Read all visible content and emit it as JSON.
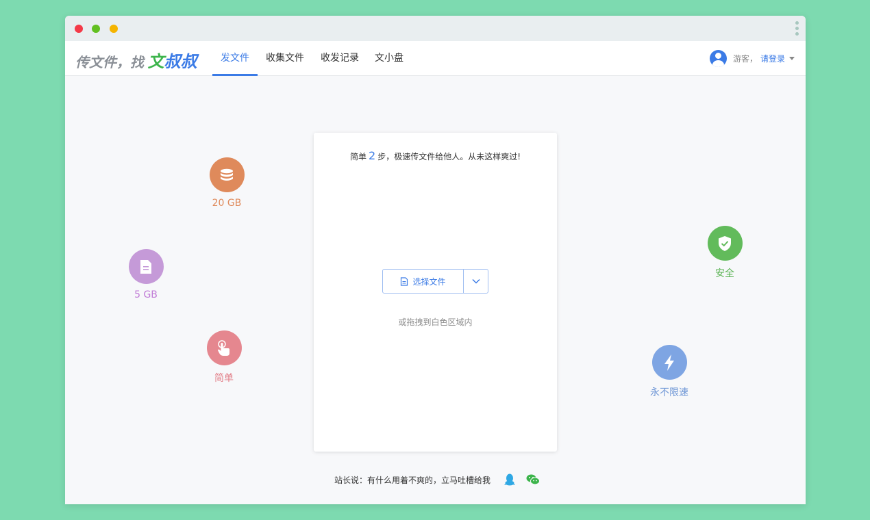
{
  "window": {
    "title_dots": [
      "close",
      "minimize",
      "maximize"
    ],
    "menu_icon": "vertical-dots-icon"
  },
  "logo": {
    "prefix": "传文件，找",
    "brand_wen": "文",
    "brand_shushu": "叔叔"
  },
  "nav": {
    "tabs": [
      {
        "label": "发文件",
        "active": true
      },
      {
        "label": "收集文件",
        "active": false
      },
      {
        "label": "收发记录",
        "active": false
      },
      {
        "label": "文小盘",
        "active": false
      }
    ]
  },
  "user": {
    "guest_label": "游客，",
    "login_label": "请登录",
    "avatar_icon": "user-avatar-icon"
  },
  "features": [
    {
      "label": "20 GB",
      "icon": "database-icon",
      "color": "#df8a5b"
    },
    {
      "label": "5 GB",
      "icon": "file-icon",
      "color": "#c59ad8"
    },
    {
      "label": "简单",
      "icon": "hand-pointer-icon",
      "color": "#e5878f"
    },
    {
      "label": "安全",
      "icon": "shield-check-icon",
      "color": "#62bb5b"
    },
    {
      "label": "永不限速",
      "icon": "lightning-icon",
      "color": "#7ea5e3"
    }
  ],
  "upload": {
    "headline_pre": "简单",
    "headline_num": "2",
    "headline_post": "步，极速传文件给他人。从未这样爽过!",
    "select_label": "选择文件",
    "drag_hint": "或拖拽到白色区域内"
  },
  "footer": {
    "text": "站长说：有什么用着不爽的，立马吐槽给我",
    "social": [
      "qq-icon",
      "wechat-icon"
    ]
  },
  "colors": {
    "accent": "#3b7be6",
    "background": "#7ddab0"
  }
}
